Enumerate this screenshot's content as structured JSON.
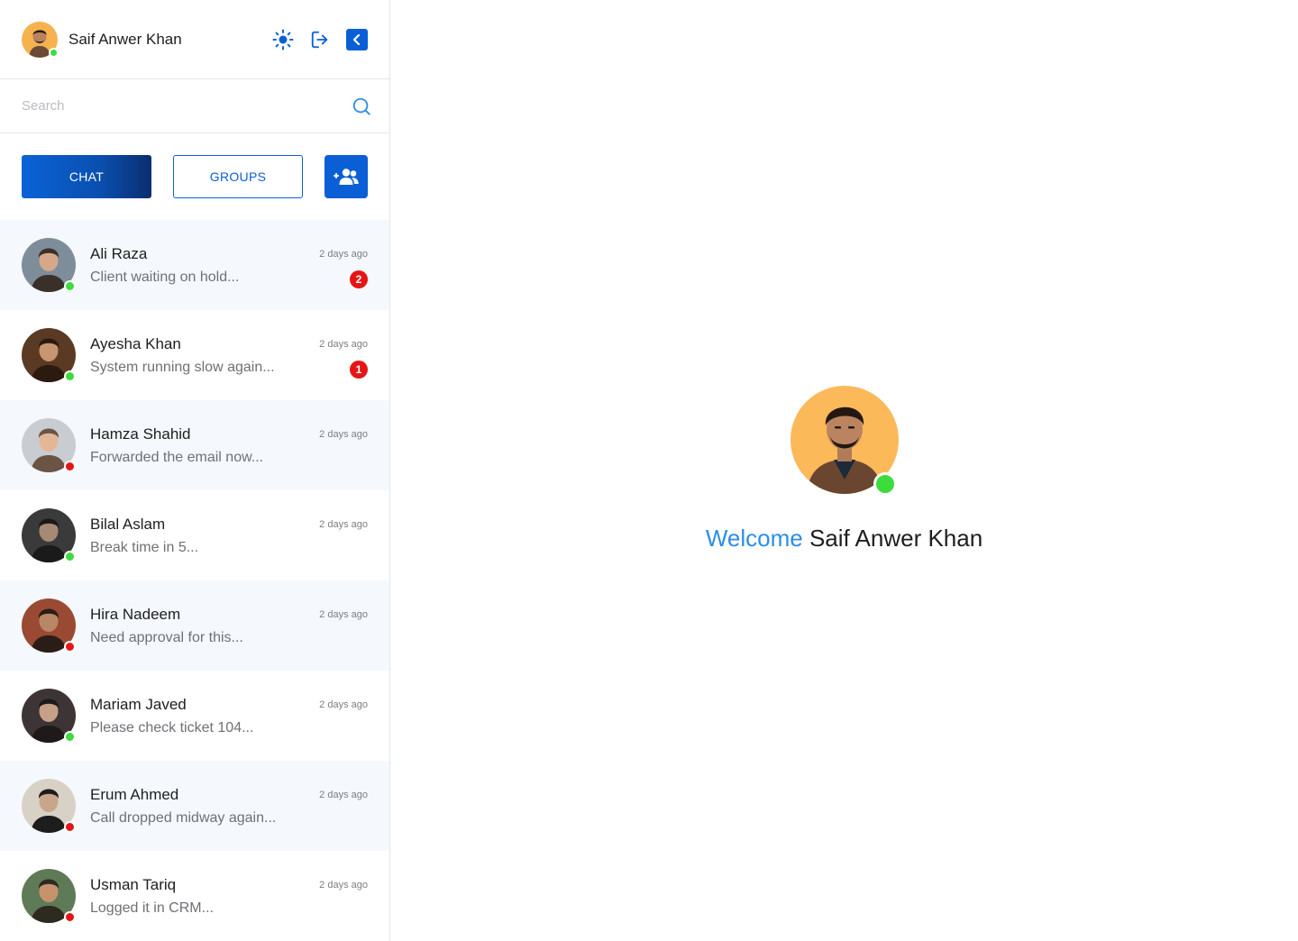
{
  "user": {
    "name": "Saif Anwer Khan",
    "status": "online"
  },
  "top_icons": [
    "sun-icon",
    "logout-icon",
    "chevron-left-icon"
  ],
  "search": {
    "placeholder": "Search"
  },
  "tabs": {
    "chat": "CHAT",
    "groups": "GROUPS"
  },
  "chats": [
    {
      "name": "Ali Raza",
      "message": "Client waiting on hold...",
      "time": "2 days ago",
      "unread": "2",
      "status": "online"
    },
    {
      "name": "Ayesha Khan",
      "message": "System running slow again...",
      "time": "2 days ago",
      "unread": "1",
      "status": "online"
    },
    {
      "name": "Hamza Shahid",
      "message": "Forwarded the email now...",
      "time": "2 days ago",
      "unread": "",
      "status": "offline"
    },
    {
      "name": "Bilal Aslam",
      "message": "Break time in 5...",
      "time": "2 days ago",
      "unread": "",
      "status": "online"
    },
    {
      "name": "Hira Nadeem",
      "message": "Need approval for this...",
      "time": "2 days ago",
      "unread": "",
      "status": "offline"
    },
    {
      "name": "Mariam Javed",
      "message": "Please check ticket 104...",
      "time": "2 days ago",
      "unread": "",
      "status": "online"
    },
    {
      "name": "Erum Ahmed",
      "message": "Call dropped midway again...",
      "time": "2 days ago",
      "unread": "",
      "status": "offline"
    },
    {
      "name": "Usman Tariq",
      "message": "Logged it in CRM...",
      "time": "2 days ago",
      "unread": "",
      "status": "offline"
    }
  ],
  "welcome": {
    "greeting": "Welcome",
    "name": "Saif Anwer Khan"
  },
  "colors": {
    "accent": "#0a5fd6",
    "online": "#3ddc3d",
    "offline": "#e61515",
    "greeting": "#2b8ee8",
    "unread_badge": "#e61515"
  }
}
